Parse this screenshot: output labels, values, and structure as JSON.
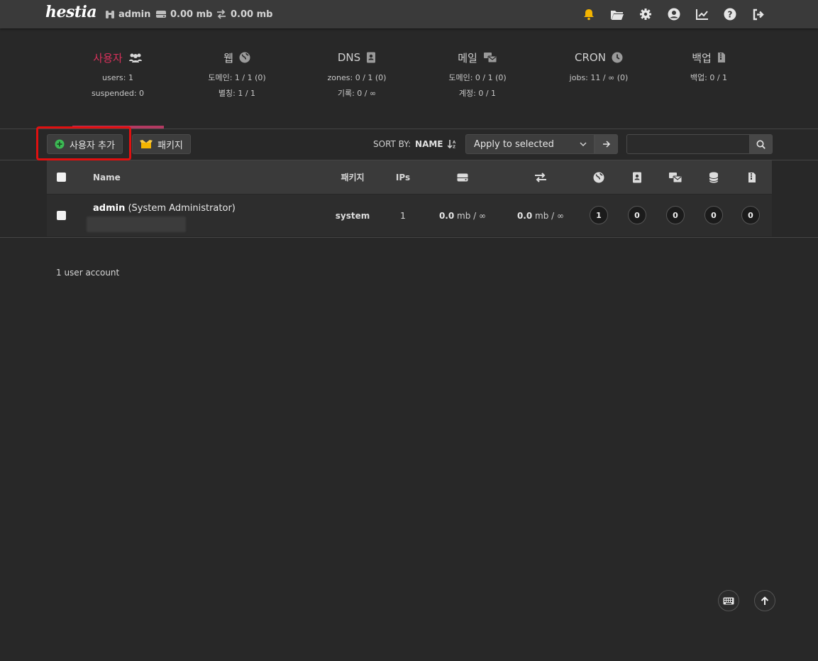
{
  "brand": {
    "logo_text": "hestia"
  },
  "topbar": {
    "user": "admin",
    "disk": "0.00 mb",
    "bandwidth": "0.00 mb",
    "icons": [
      "bell-icon",
      "folder-icon",
      "gear-icon",
      "user-circle-icon",
      "chart-line-icon",
      "help-icon",
      "logout-icon"
    ],
    "bell_color": "#f4b400"
  },
  "tabs": [
    {
      "title": "사용자",
      "icon": "users-icon",
      "lines": [
        "users: 1",
        "suspended: 0"
      ],
      "active": true
    },
    {
      "title": "웹",
      "icon": "globe-icon",
      "lines": [
        "도메인: 1 / 1 (0)",
        "별칭: 1 / 1"
      ]
    },
    {
      "title": "DNS",
      "icon": "address-book-icon",
      "lines": [
        "zones: 0 / 1 (0)",
        "기록: 0 / ∞"
      ]
    },
    {
      "title": "메일",
      "icon": "mail-bulk-icon",
      "lines": [
        "도메인: 0 / 1 (0)",
        "계정: 0 / 1"
      ]
    },
    {
      "title": "CRON",
      "icon": "clock-icon",
      "lines": [
        "jobs: 11 / ∞ (0)"
      ]
    },
    {
      "title": "백업",
      "icon": "file-zipper-icon",
      "lines": [
        "백업: 0 / 1"
      ]
    }
  ],
  "toolbar": {
    "add_user_label": "사용자 추가",
    "packages_label": "패키지",
    "sort_label": "SORT BY:",
    "sort_value": "NAME",
    "bulk_select_value": "Apply to selected",
    "search_placeholder": ""
  },
  "table": {
    "headers": {
      "name": "Name",
      "package": "패키지",
      "ips": "IPs"
    },
    "rows": [
      {
        "username": "admin",
        "fullname": "(System Administrator)",
        "package": "system",
        "ips": "1",
        "disk": {
          "value": "0.0",
          "unit": "mb / ∞"
        },
        "bandwidth": {
          "value": "0.0",
          "unit": "mb / ∞"
        },
        "web": "1",
        "dns": "0",
        "mail": "0",
        "db": "0",
        "backups": "0"
      }
    ]
  },
  "footer": {
    "count_text": "1 user account"
  },
  "colors": {
    "accent": "#d8315b",
    "add_icon": "#3cba54",
    "package_icon": "#f4b400"
  }
}
